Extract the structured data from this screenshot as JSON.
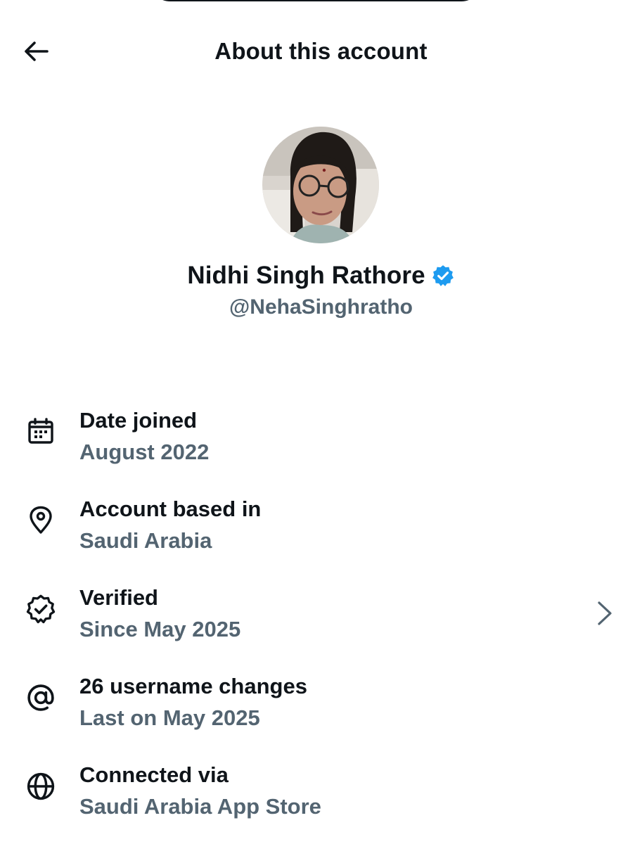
{
  "header": {
    "title": "About this account",
    "back_icon": "arrow-left-icon"
  },
  "profile": {
    "display_name": "Nidhi Singh Rathore",
    "handle": "@NehaSinghratho",
    "verified_badge_icon": "verified-badge-icon",
    "badge_color": "#1d9bf0"
  },
  "details": [
    {
      "icon": "calendar-icon",
      "label": "Date joined",
      "value": "August 2022"
    },
    {
      "icon": "location-pin-icon",
      "label": "Account based in",
      "value": "Saudi Arabia"
    },
    {
      "icon": "verified-outline-icon",
      "label": "Verified",
      "value": "Since May 2025",
      "has_chevron": true
    },
    {
      "icon": "at-sign-icon",
      "label": "26 username changes",
      "value": "Last on May 2025"
    },
    {
      "icon": "globe-icon",
      "label": "Connected via",
      "value": "Saudi Arabia App Store"
    }
  ],
  "colors": {
    "primary_text": "#0f1419",
    "secondary_text": "#536471",
    "accent": "#1d9bf0"
  }
}
